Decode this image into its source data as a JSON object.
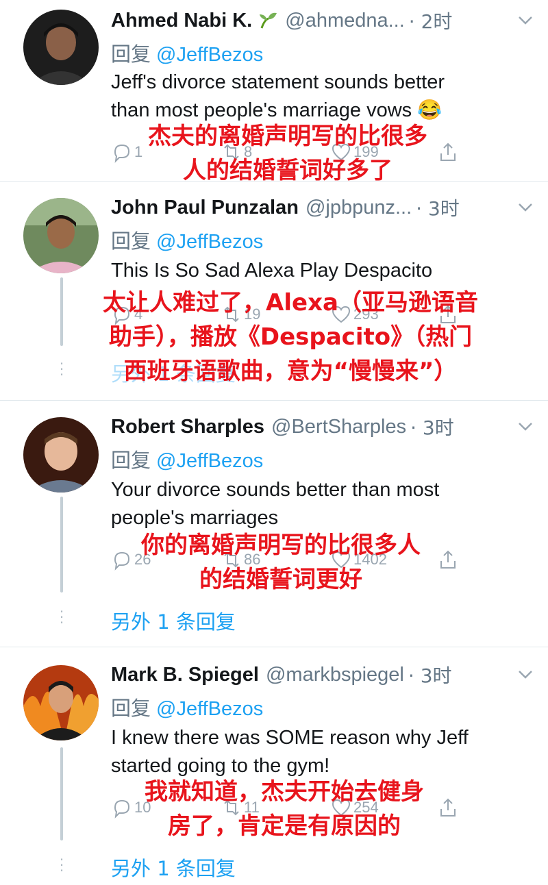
{
  "tweets": [
    {
      "name": "Ahmed Nabi K.",
      "handle": "@ahmedna...",
      "time": "· 2时",
      "reply_word": "回复",
      "reply_to": "@JeffBezos",
      "text_lines": [
        "Jeff's divorce statement sounds better",
        "than most people's marriage vows 😂"
      ],
      "replies": "1",
      "retweets": "8",
      "likes": "199",
      "overlay_lines": [
        "杰夫的离婚声明写的比很多",
        "人的结婚誓词好多了"
      ],
      "avatar_icon": "avatar-photo"
    },
    {
      "name": "John Paul Punzalan",
      "handle": "@jpbpunz...",
      "time": "· 3时",
      "reply_word": "回复",
      "reply_to": "@JeffBezos",
      "text_lines": [
        "This Is So Sad Alexa Play Despacito"
      ],
      "replies": "4",
      "retweets": "19",
      "likes": "293",
      "more_replies": "另外 1 条回复",
      "overlay_lines": [
        "太让人难过了，Alexa（亚马逊语音",
        "助手），播放《Despacito》（热门",
        "西班牙语歌曲，意为“慢慢来”）"
      ],
      "avatar_icon": "avatar-photo"
    },
    {
      "name": "Robert Sharples",
      "handle": "@BertSharples",
      "time": "· 3时",
      "reply_word": "回复",
      "reply_to": "@JeffBezos",
      "text_lines": [
        "Your divorce sounds better than most",
        "people's marriages"
      ],
      "replies": "26",
      "retweets": "86",
      "likes": "1402",
      "more_replies": "另外 1 条回复",
      "overlay_lines": [
        "你的离婚声明写的比很多人",
        "的结婚誓词更好"
      ],
      "avatar_icon": "avatar-photo"
    },
    {
      "name": "Mark B. Spiegel",
      "handle": "@markbspiegel",
      "time": "· 3时",
      "reply_word": "回复",
      "reply_to": "@JeffBezos",
      "text_lines": [
        "I knew there was SOME reason why Jeff",
        "started going to the gym!"
      ],
      "replies": "10",
      "retweets": "11",
      "likes": "254",
      "more_replies": "另外 1 条回复",
      "overlay_lines": [
        "我就知道，杰夫开始去健身",
        "房了，肯定是有原因的"
      ],
      "avatar_icon": "avatar-photo"
    }
  ],
  "colors": {
    "link": "#1da1f2",
    "muted": "#657786",
    "overlay": "#e8141c",
    "divider": "#e1e8ed"
  }
}
